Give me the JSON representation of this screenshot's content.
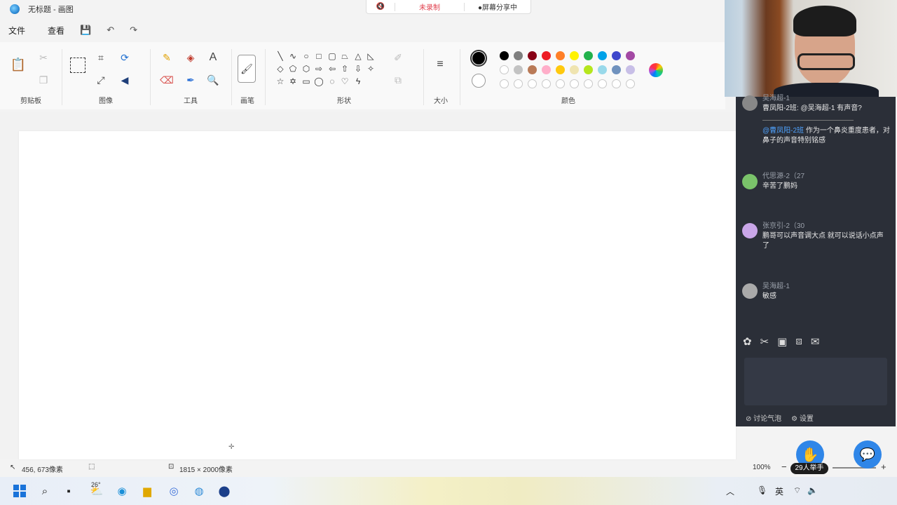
{
  "window": {
    "title": "无标题 - 画图"
  },
  "recording_bar": {
    "record_label": "未录制",
    "share_label": "●屏幕分享中"
  },
  "menu": {
    "file": "文件",
    "view": "查看"
  },
  "ribbon": {
    "groups": {
      "clipboard": "剪贴板",
      "image": "图像",
      "tools": "工具",
      "brushes": "画笔",
      "shapes": "形状",
      "size": "大小",
      "colors": "颜色"
    },
    "tool_text_glyph": "A",
    "palette": {
      "row1": [
        "#000000",
        "#7f7f7f",
        "#880015",
        "#ed1c24",
        "#ff7f27",
        "#fff200",
        "#22b14c",
        "#00a2e8",
        "#3f48cc",
        "#a349a4"
      ],
      "row2": [
        "#ffffff",
        "#c3c3c3",
        "#b97a57",
        "#ffaec9",
        "#ffc90e",
        "#efe4b0",
        "#b5e61d",
        "#99d9ea",
        "#7092be",
        "#c8bfe7"
      ],
      "current_color1": "#000000",
      "current_color2": "#ffffff"
    }
  },
  "status": {
    "cursor_pos": "456, 673像素",
    "canvas_size": "1815 × 2000像素",
    "zoom": "100%"
  },
  "chat": {
    "messages": [
      {
        "name": "吴海超-1",
        "text": "曹凤阳-2班: @吴海超-1  有声音?"
      },
      {
        "mention": "@曹凤阳-2班",
        "text": " 作为一个鼻炎重度患者，对鼻子的声音特别铭感"
      },
      {
        "name": "代思源-2（27",
        "text": "辛苦了鹏妈"
      },
      {
        "name": "张京引-2（30",
        "text": "鹏哥可以声音调大点 就可以说话小点声了"
      },
      {
        "name": "吴海超-1",
        "text": "敏感"
      }
    ],
    "footer": {
      "bubble": "讨论气泡",
      "settings": "设置"
    }
  },
  "hand_badge": "29人举手",
  "taskbar": {
    "temperature": "26°",
    "ime": "英"
  }
}
